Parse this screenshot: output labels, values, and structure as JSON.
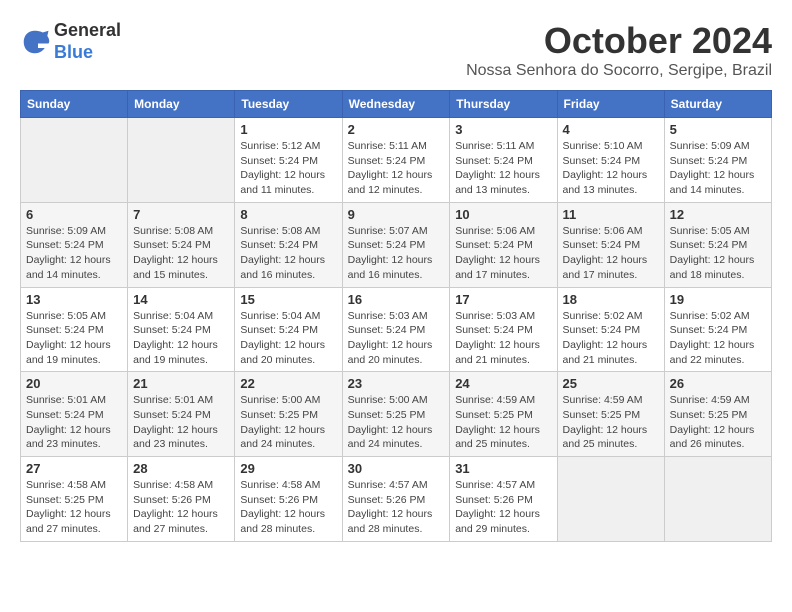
{
  "logo": {
    "line1": "General",
    "line2": "Blue"
  },
  "header": {
    "month": "October 2024",
    "location": "Nossa Senhora do Socorro, Sergipe, Brazil"
  },
  "weekdays": [
    "Sunday",
    "Monday",
    "Tuesday",
    "Wednesday",
    "Thursday",
    "Friday",
    "Saturday"
  ],
  "weeks": [
    [
      {
        "day": "",
        "info": ""
      },
      {
        "day": "",
        "info": ""
      },
      {
        "day": "1",
        "info": "Sunrise: 5:12 AM\nSunset: 5:24 PM\nDaylight: 12 hours and 11 minutes."
      },
      {
        "day": "2",
        "info": "Sunrise: 5:11 AM\nSunset: 5:24 PM\nDaylight: 12 hours and 12 minutes."
      },
      {
        "day": "3",
        "info": "Sunrise: 5:11 AM\nSunset: 5:24 PM\nDaylight: 12 hours and 13 minutes."
      },
      {
        "day": "4",
        "info": "Sunrise: 5:10 AM\nSunset: 5:24 PM\nDaylight: 12 hours and 13 minutes."
      },
      {
        "day": "5",
        "info": "Sunrise: 5:09 AM\nSunset: 5:24 PM\nDaylight: 12 hours and 14 minutes."
      }
    ],
    [
      {
        "day": "6",
        "info": "Sunrise: 5:09 AM\nSunset: 5:24 PM\nDaylight: 12 hours and 14 minutes."
      },
      {
        "day": "7",
        "info": "Sunrise: 5:08 AM\nSunset: 5:24 PM\nDaylight: 12 hours and 15 minutes."
      },
      {
        "day": "8",
        "info": "Sunrise: 5:08 AM\nSunset: 5:24 PM\nDaylight: 12 hours and 16 minutes."
      },
      {
        "day": "9",
        "info": "Sunrise: 5:07 AM\nSunset: 5:24 PM\nDaylight: 12 hours and 16 minutes."
      },
      {
        "day": "10",
        "info": "Sunrise: 5:06 AM\nSunset: 5:24 PM\nDaylight: 12 hours and 17 minutes."
      },
      {
        "day": "11",
        "info": "Sunrise: 5:06 AM\nSunset: 5:24 PM\nDaylight: 12 hours and 17 minutes."
      },
      {
        "day": "12",
        "info": "Sunrise: 5:05 AM\nSunset: 5:24 PM\nDaylight: 12 hours and 18 minutes."
      }
    ],
    [
      {
        "day": "13",
        "info": "Sunrise: 5:05 AM\nSunset: 5:24 PM\nDaylight: 12 hours and 19 minutes."
      },
      {
        "day": "14",
        "info": "Sunrise: 5:04 AM\nSunset: 5:24 PM\nDaylight: 12 hours and 19 minutes."
      },
      {
        "day": "15",
        "info": "Sunrise: 5:04 AM\nSunset: 5:24 PM\nDaylight: 12 hours and 20 minutes."
      },
      {
        "day": "16",
        "info": "Sunrise: 5:03 AM\nSunset: 5:24 PM\nDaylight: 12 hours and 20 minutes."
      },
      {
        "day": "17",
        "info": "Sunrise: 5:03 AM\nSunset: 5:24 PM\nDaylight: 12 hours and 21 minutes."
      },
      {
        "day": "18",
        "info": "Sunrise: 5:02 AM\nSunset: 5:24 PM\nDaylight: 12 hours and 21 minutes."
      },
      {
        "day": "19",
        "info": "Sunrise: 5:02 AM\nSunset: 5:24 PM\nDaylight: 12 hours and 22 minutes."
      }
    ],
    [
      {
        "day": "20",
        "info": "Sunrise: 5:01 AM\nSunset: 5:24 PM\nDaylight: 12 hours and 23 minutes."
      },
      {
        "day": "21",
        "info": "Sunrise: 5:01 AM\nSunset: 5:24 PM\nDaylight: 12 hours and 23 minutes."
      },
      {
        "day": "22",
        "info": "Sunrise: 5:00 AM\nSunset: 5:25 PM\nDaylight: 12 hours and 24 minutes."
      },
      {
        "day": "23",
        "info": "Sunrise: 5:00 AM\nSunset: 5:25 PM\nDaylight: 12 hours and 24 minutes."
      },
      {
        "day": "24",
        "info": "Sunrise: 4:59 AM\nSunset: 5:25 PM\nDaylight: 12 hours and 25 minutes."
      },
      {
        "day": "25",
        "info": "Sunrise: 4:59 AM\nSunset: 5:25 PM\nDaylight: 12 hours and 25 minutes."
      },
      {
        "day": "26",
        "info": "Sunrise: 4:59 AM\nSunset: 5:25 PM\nDaylight: 12 hours and 26 minutes."
      }
    ],
    [
      {
        "day": "27",
        "info": "Sunrise: 4:58 AM\nSunset: 5:25 PM\nDaylight: 12 hours and 27 minutes."
      },
      {
        "day": "28",
        "info": "Sunrise: 4:58 AM\nSunset: 5:26 PM\nDaylight: 12 hours and 27 minutes."
      },
      {
        "day": "29",
        "info": "Sunrise: 4:58 AM\nSunset: 5:26 PM\nDaylight: 12 hours and 28 minutes."
      },
      {
        "day": "30",
        "info": "Sunrise: 4:57 AM\nSunset: 5:26 PM\nDaylight: 12 hours and 28 minutes."
      },
      {
        "day": "31",
        "info": "Sunrise: 4:57 AM\nSunset: 5:26 PM\nDaylight: 12 hours and 29 minutes."
      },
      {
        "day": "",
        "info": ""
      },
      {
        "day": "",
        "info": ""
      }
    ]
  ]
}
